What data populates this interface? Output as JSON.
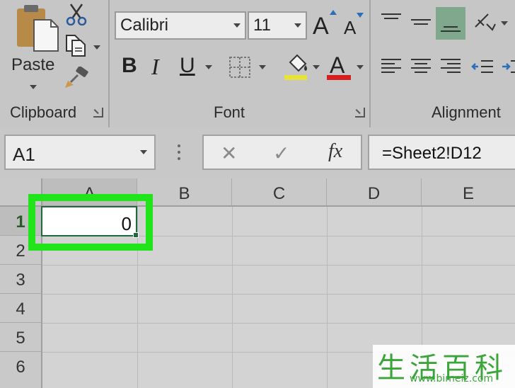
{
  "ribbon": {
    "clipboard": {
      "paste_label": "Paste",
      "group_label": "Clipboard",
      "icons": [
        "paste-clipboard-icon",
        "scissors-icon",
        "copy-icon",
        "format-painter-icon"
      ]
    },
    "font": {
      "font_name": "Calibri",
      "font_size": "11",
      "bold": "B",
      "italic": "I",
      "underline": "U",
      "grow_letter": "A",
      "shrink_letter": "A",
      "font_color_letter": "A",
      "group_label": "Font",
      "highlight_color": "#e8e23a",
      "font_color": "#d42020"
    },
    "alignment": {
      "group_label": "Alignment",
      "selected_color": "#7fa88c"
    }
  },
  "formula_bar": {
    "name_box": "A1",
    "cancel_symbol": "✕",
    "enter_symbol": "✓",
    "fx_label": "fx",
    "formula": "=Sheet2!D12"
  },
  "sheet": {
    "columns": [
      "A",
      "B",
      "C",
      "D",
      "E"
    ],
    "rows": [
      "1",
      "2",
      "3",
      "4",
      "5",
      "6"
    ],
    "active_cell": {
      "ref": "A1",
      "value": "0"
    },
    "highlight_color": "#22e41a"
  },
  "watermark": {
    "chinese": "生活百科",
    "url": "www.bimeiz.com"
  }
}
